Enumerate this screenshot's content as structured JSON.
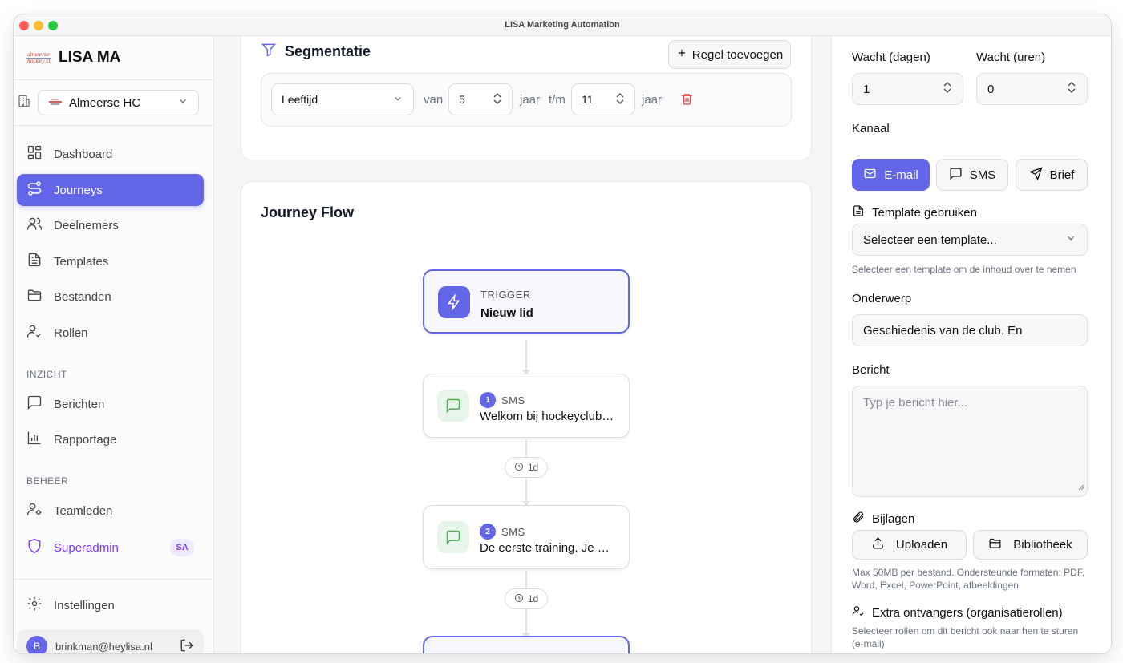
{
  "window": {
    "title": "LISA Marketing Automation"
  },
  "sidebar": {
    "brand": "LISA MA",
    "logo_text": "Almeerse Hockey club",
    "org": "Almeerse HC",
    "nav": [
      {
        "label": "Dashboard",
        "icon": "dashboard-icon"
      },
      {
        "label": "Journeys",
        "icon": "route-icon",
        "active": true
      },
      {
        "label": "Deelnemers",
        "icon": "users-icon"
      },
      {
        "label": "Templates",
        "icon": "file-text-icon"
      },
      {
        "label": "Bestanden",
        "icon": "folder-icon"
      },
      {
        "label": "Rollen",
        "icon": "user-check-icon"
      }
    ],
    "section_inzicht": "INZICHT",
    "nav_inzicht": [
      {
        "label": "Berichten",
        "icon": "message-square-icon"
      },
      {
        "label": "Rapportage",
        "icon": "bar-chart-icon"
      }
    ],
    "section_beheer": "BEHEER",
    "nav_beheer": [
      {
        "label": "Teamleden",
        "icon": "user-cog-icon"
      },
      {
        "label": "Superadmin",
        "icon": "shield-icon",
        "badge": "SA"
      }
    ],
    "settings": "Instellingen",
    "user_email": "brinkman@heylisa.nl",
    "user_initial": "B"
  },
  "segmentation": {
    "title": "Segmentatie",
    "add_rule": "Regel toevoegen",
    "rule": {
      "field": "Leeftijd",
      "from_label": "van",
      "from_value": "5",
      "unit1": "jaar",
      "to_label": "t/m",
      "to_value": "11",
      "unit2": "jaar"
    }
  },
  "flow": {
    "title": "Journey Flow",
    "trigger": {
      "kind": "TRIGGER",
      "label": "Nieuw lid"
    },
    "steps": [
      {
        "num": "1",
        "kind": "SMS",
        "text": "Welkom bij hockeyclub Almeerse"
      },
      {
        "num": "2",
        "kind": "SMS",
        "text": "De eerste training. Je moet"
      }
    ],
    "delays": [
      "1d",
      "1d"
    ]
  },
  "panel": {
    "wait_days_label": "Wacht (dagen)",
    "wait_days_value": "1",
    "wait_hours_label": "Wacht (uren)",
    "wait_hours_value": "0",
    "channel_label": "Kanaal",
    "channels": [
      "E-mail",
      "SMS",
      "Brief"
    ],
    "channel_selected": "E-mail",
    "template_label": "Template gebruiken",
    "template_select": "Selecteer een template...",
    "template_hint": "Selecteer een template om de inhoud over te nemen",
    "subject_label": "Onderwerp",
    "subject_value": "Geschiedenis van de club. En",
    "message_label": "Bericht",
    "message_placeholder": "Typ je bericht hier...",
    "attachments_label": "Bijlagen",
    "upload": "Uploaden",
    "library": "Bibliotheek",
    "attach_hint": "Max 50MB per bestand. Ondersteunde formaten: PDF, Word, Excel, PowerPoint, afbeeldingen.",
    "extra_label": "Extra ontvangers (organisatierollen)",
    "extra_hint": "Selecteer rollen om dit bericht ook naar hen te sturen (e-mail)"
  },
  "colors": {
    "accent": "#6366e8",
    "danger": "#e53e3e",
    "sms_green": "#4caf50"
  }
}
